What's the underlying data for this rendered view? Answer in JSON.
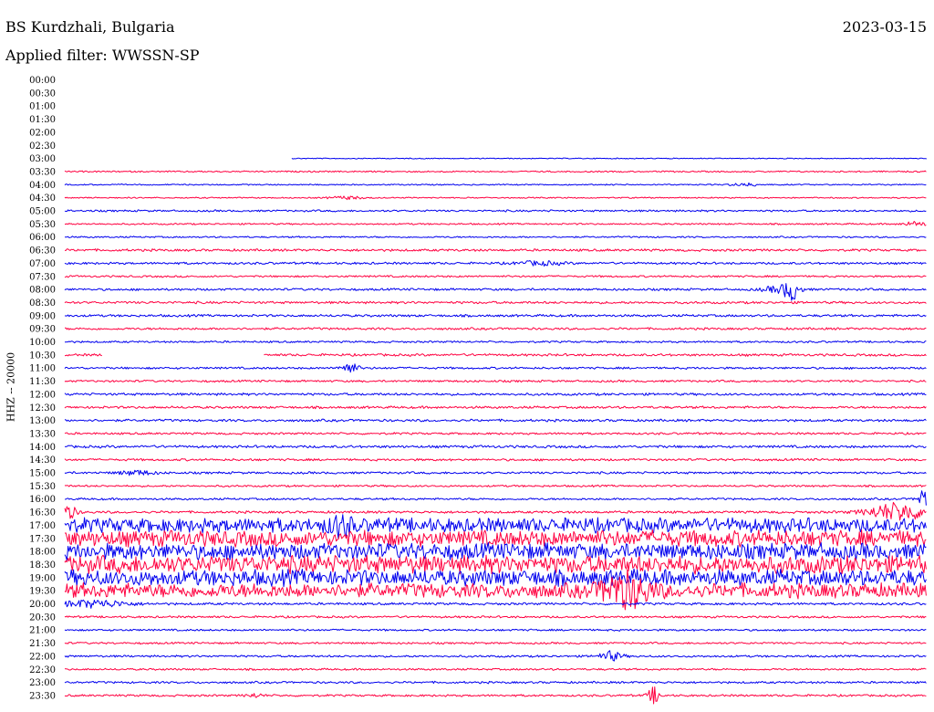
{
  "header": {
    "station": "BS Kurdzhali, Bulgaria",
    "date": "2023-03-15",
    "filter_label": "Applied filter: WWSSN-SP",
    "channel_label": "HHZ -- 20000"
  },
  "colors": {
    "blue": "#0000ee",
    "red": "#ff0040"
  },
  "chart_data": {
    "type": "line",
    "title": "BS Kurdzhali, Bulgaria",
    "subtitle": "Applied filter: WWSSN-SP",
    "ylabel": "HHZ -- 20000",
    "xlim": [
      0,
      30
    ],
    "x_unit": "minutes",
    "trace_interval_minutes": 30,
    "ytick_labels": [
      "00:00",
      "00:30",
      "01:00",
      "01:30",
      "02:00",
      "02:30",
      "03:00",
      "03:30",
      "04:00",
      "04:30",
      "05:00",
      "05:30",
      "06:00",
      "06:30",
      "07:00",
      "07:30",
      "08:00",
      "08:30",
      "09:00",
      "09:30",
      "10:00",
      "10:30",
      "11:00",
      "11:30",
      "12:00",
      "12:30",
      "13:00",
      "13:30",
      "14:00",
      "14:30",
      "15:00",
      "15:30",
      "16:00",
      "16:30",
      "17:00",
      "17:30",
      "18:00",
      "18:30",
      "19:00",
      "19:30",
      "20:00",
      "20:30",
      "21:00",
      "21:30",
      "22:00",
      "22:30",
      "23:00",
      "23:30"
    ],
    "series": [
      {
        "start": "03:00",
        "color": "blue",
        "amp": 0.6,
        "from": 7.9
      },
      {
        "start": "03:30",
        "color": "red",
        "amp": 0.9
      },
      {
        "start": "04:00",
        "color": "blue",
        "amp": 0.8,
        "events": [
          {
            "t": 23.7,
            "a": 1.6,
            "w": 0.5
          }
        ]
      },
      {
        "start": "04:30",
        "color": "red",
        "amp": 0.8,
        "events": [
          {
            "t": 9.8,
            "a": 1.5,
            "w": 0.6
          }
        ]
      },
      {
        "start": "05:00",
        "color": "blue",
        "amp": 1.2
      },
      {
        "start": "05:30",
        "color": "red",
        "amp": 1.0,
        "events": [
          {
            "t": 29.6,
            "a": 2.5,
            "w": 0.4
          }
        ]
      },
      {
        "start": "06:00",
        "color": "blue",
        "amp": 1.0
      },
      {
        "start": "06:30",
        "color": "red",
        "amp": 1.5
      },
      {
        "start": "07:00",
        "color": "blue",
        "amp": 1.4,
        "events": [
          {
            "t": 16.5,
            "a": 2.0,
            "w": 0.8
          }
        ]
      },
      {
        "start": "07:30",
        "color": "red",
        "amp": 1.2
      },
      {
        "start": "08:00",
        "color": "blue",
        "amp": 1.4,
        "events": [
          {
            "t": 24.9,
            "a": 3.5,
            "w": 0.6
          },
          {
            "t": 25.3,
            "a": 10,
            "w": 0.25
          }
        ]
      },
      {
        "start": "08:30",
        "color": "red",
        "amp": 1.5
      },
      {
        "start": "09:00",
        "color": "blue",
        "amp": 1.5
      },
      {
        "start": "09:30",
        "color": "red",
        "amp": 1.4
      },
      {
        "start": "10:00",
        "color": "blue",
        "amp": 1.2
      },
      {
        "start": "10:30",
        "color": "red",
        "amp": 1.5,
        "gaps": [
          [
            1.3,
            6.9
          ]
        ]
      },
      {
        "start": "11:00",
        "color": "blue",
        "amp": 1.3,
        "events": [
          {
            "t": 9.9,
            "a": 6,
            "w": 0.3
          }
        ]
      },
      {
        "start": "11:30",
        "color": "red",
        "amp": 1.3
      },
      {
        "start": "12:00",
        "color": "blue",
        "amp": 1.5
      },
      {
        "start": "12:30",
        "color": "red",
        "amp": 1.5
      },
      {
        "start": "13:00",
        "color": "blue",
        "amp": 1.5
      },
      {
        "start": "13:30",
        "color": "red",
        "amp": 1.3
      },
      {
        "start": "14:00",
        "color": "blue",
        "amp": 1.6
      },
      {
        "start": "14:30",
        "color": "red",
        "amp": 1.4
      },
      {
        "start": "15:00",
        "color": "blue",
        "amp": 1.4,
        "events": [
          {
            "t": 2.5,
            "a": 2.5,
            "w": 0.6
          }
        ]
      },
      {
        "start": "15:30",
        "color": "red",
        "amp": 1.2
      },
      {
        "start": "16:00",
        "color": "blue",
        "amp": 1.3,
        "events": [
          {
            "t": 29.9,
            "a": 12,
            "w": 0.2
          }
        ]
      },
      {
        "start": "16:30",
        "color": "red",
        "amp": 1.5,
        "events": [
          {
            "t": 0.1,
            "a": 8,
            "w": 0.3
          },
          {
            "t": 29.0,
            "a": 10,
            "w": 1.0
          }
        ]
      },
      {
        "start": "17:00",
        "color": "blue",
        "amp": 9,
        "events": [
          {
            "t": 9.6,
            "a": 8,
            "w": 0.4
          }
        ]
      },
      {
        "start": "17:30",
        "color": "red",
        "amp": 10
      },
      {
        "start": "18:00",
        "color": "blue",
        "amp": 10
      },
      {
        "start": "18:30",
        "color": "red",
        "amp": 11
      },
      {
        "start": "19:00",
        "color": "blue",
        "amp": 10
      },
      {
        "start": "19:30",
        "color": "red",
        "amp": 9,
        "events": [
          {
            "t": 19.5,
            "a": 16,
            "w": 0.8
          }
        ]
      },
      {
        "start": "20:00",
        "color": "blue",
        "amp": 1.5,
        "events": [
          {
            "t": 1.0,
            "a": 4,
            "w": 1.2
          }
        ]
      },
      {
        "start": "20:30",
        "color": "red",
        "amp": 1.3
      },
      {
        "start": "21:00",
        "color": "blue",
        "amp": 1.2
      },
      {
        "start": "21:30",
        "color": "red",
        "amp": 1.2
      },
      {
        "start": "22:00",
        "color": "blue",
        "amp": 1.3,
        "events": [
          {
            "t": 19.0,
            "a": 5,
            "w": 0.4
          }
        ]
      },
      {
        "start": "22:30",
        "color": "red",
        "amp": 1.2
      },
      {
        "start": "23:00",
        "color": "blue",
        "amp": 1.3
      },
      {
        "start": "23:30",
        "color": "red",
        "amp": 1.3,
        "events": [
          {
            "t": 20.5,
            "a": 9,
            "w": 0.2
          },
          {
            "t": 6.6,
            "a": 2,
            "w": 0.3
          }
        ]
      }
    ]
  }
}
